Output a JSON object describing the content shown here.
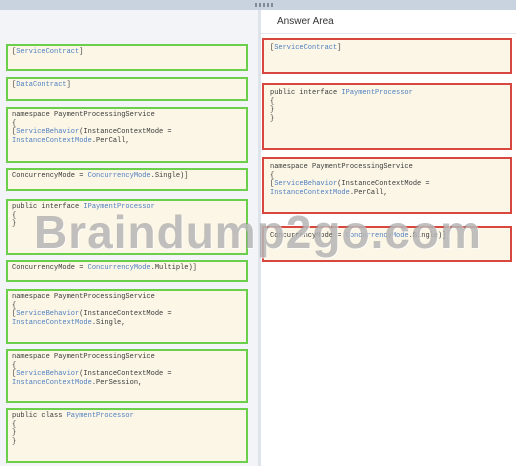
{
  "answer_area": {
    "title": "Answer Area"
  },
  "source_items": [
    {
      "lines": [
        [
          "[",
          "ServiceContract",
          "]"
        ]
      ]
    },
    {
      "lines": [
        [
          "[",
          "DataContract",
          "]"
        ]
      ]
    },
    {
      "lines": [
        [
          "namespace PaymentProcessingService",
          "",
          ""
        ],
        [
          "{",
          "",
          ""
        ],
        [
          "[",
          "ServiceBehavior",
          "(InstanceContextMode ="
        ],
        [
          "",
          "InstanceContextMode",
          ".PerCall,"
        ]
      ]
    },
    {
      "lines": [
        [
          "ConcurrencyMode = ",
          "ConcurrencyMode",
          ".Single)]"
        ]
      ]
    },
    {
      "lines": [
        [
          "public interface ",
          "IPaymentProcessor",
          ""
        ],
        [
          "{",
          "",
          ""
        ],
        [
          "}",
          "",
          ""
        ]
      ]
    },
    {
      "lines": [
        [
          "ConcurrencyMode = ",
          "ConcurrencyMode",
          ".Multiple)]"
        ]
      ]
    },
    {
      "lines": [
        [
          "namespace PaymentProcessingService",
          "",
          ""
        ],
        [
          "{",
          "",
          ""
        ],
        [
          "[",
          "ServiceBehavior",
          "(InstanceContextMode ="
        ],
        [
          "",
          "InstanceContextMode",
          ".Single,"
        ]
      ]
    },
    {
      "lines": [
        [
          "namespace PaymentProcessingService",
          "",
          ""
        ],
        [
          "{",
          "",
          ""
        ],
        [
          "[",
          "ServiceBehavior",
          "(InstanceContextMode ="
        ],
        [
          "",
          "InstanceContextMode",
          ".PerSession,"
        ]
      ]
    },
    {
      "lines": [
        [
          "public class ",
          "PaymentProcessor",
          ""
        ],
        [
          "{",
          "",
          ""
        ],
        [
          "}",
          "",
          ""
        ],
        [
          "}",
          "",
          ""
        ]
      ]
    }
  ],
  "target_slots": [
    {
      "lines": [
        [
          "[",
          "ServiceContract",
          "]"
        ]
      ]
    },
    {
      "lines": [
        [
          "public interface ",
          "IPaymentProcessor",
          ""
        ],
        [
          "{",
          "",
          ""
        ],
        [
          "}",
          "",
          ""
        ],
        [
          "}",
          "",
          ""
        ]
      ]
    },
    {
      "lines": [
        [
          "namespace PaymentProcessingService",
          "",
          ""
        ],
        [
          "{",
          "",
          ""
        ],
        [
          "[",
          "ServiceBehavior",
          "(InstanceContextMode ="
        ],
        [
          "",
          "InstanceContextMode",
          ".PerCall,"
        ]
      ]
    },
    {
      "lines": [
        [
          "ConcurrencyMode = ",
          "ConcurrencyMode",
          ".Single)]"
        ]
      ]
    }
  ],
  "watermark": {
    "text": "Braindump2go.com"
  }
}
